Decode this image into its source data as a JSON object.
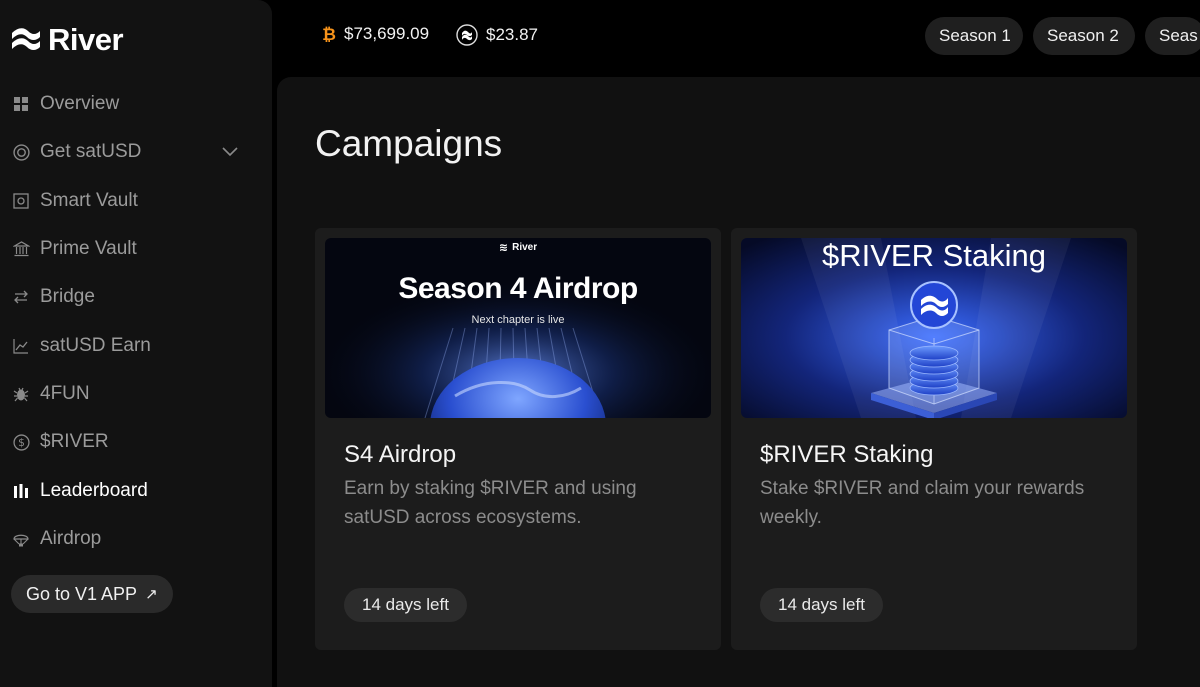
{
  "brand": {
    "name": "River"
  },
  "nav": {
    "items": [
      {
        "label": "Overview",
        "icon": "grid-icon"
      },
      {
        "label": "Get satUSD",
        "icon": "target-icon",
        "has_chevron": true
      },
      {
        "label": "Smart Vault",
        "icon": "vault-icon"
      },
      {
        "label": "Prime Vault",
        "icon": "bank-icon"
      },
      {
        "label": "Bridge",
        "icon": "swap-arrows-icon"
      },
      {
        "label": "satUSD Earn",
        "icon": "chart-line-icon"
      },
      {
        "label": "4FUN",
        "icon": "bug-icon"
      },
      {
        "label": "$RIVER",
        "icon": "dollar-circle-icon"
      },
      {
        "label": "Leaderboard",
        "icon": "bars-icon",
        "active": true
      },
      {
        "label": "Airdrop",
        "icon": "parachute-icon"
      }
    ],
    "v1_button": {
      "label": "Go to V1 APP",
      "icon": "arrow-up-right-icon"
    }
  },
  "topbar": {
    "btc_price": "$73,699.09",
    "sat_price": "$23.87",
    "seasons": [
      "Season 1",
      "Season 2",
      "Seas"
    ]
  },
  "main": {
    "title": "Campaigns",
    "cards": [
      {
        "title": "S4 Airdrop",
        "description": "Earn by staking $RIVER and using satUSD across ecosystems.",
        "badge": "14 days left",
        "image": {
          "brand": "River",
          "headline": "Season 4 Airdrop",
          "subline": "Next chapter is live"
        }
      },
      {
        "title": "$RIVER Staking",
        "description": "Stake $RIVER and claim your rewards weekly.",
        "badge": "14 days left",
        "image": {
          "headline": "$RIVER Staking"
        }
      }
    ]
  },
  "colors": {
    "background": "#000000",
    "sidebar": "#121212",
    "panel": "#111111",
    "card": "#1c1c1c",
    "btc": "#f7931a"
  }
}
